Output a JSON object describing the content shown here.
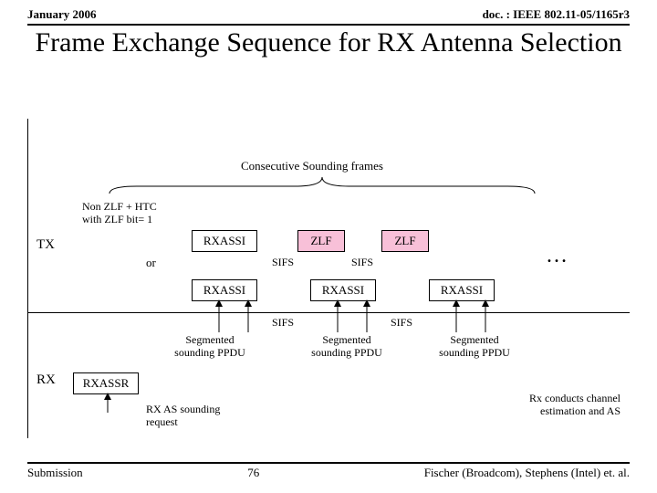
{
  "header": {
    "date": "January 2006",
    "docref": "doc. : IEEE 802.11-05/1165r3"
  },
  "title": "Frame Exchange Sequence for RX Antenna Selection",
  "footer": {
    "left": "Submission",
    "slide": "76",
    "right": "Fischer (Broadcom), Stephens (Intel) et. al."
  },
  "roles": {
    "tx": "TX",
    "rx": "RX"
  },
  "labels": {
    "consecutive": "Consecutive Sounding frames",
    "nonzlf_line1": "Non ZLF + HTC",
    "nonzlf_line2": "with ZLF bit= 1",
    "or": "or",
    "sifs": "SIFS",
    "segppdu_line1": "Segmented",
    "segppdu_line2": "sounding PPDU",
    "rxreq_line1": "RX AS sounding",
    "rxreq_line2": "request",
    "rxconducts_line1": "Rx conducts channel",
    "rxconducts_line2": "estimation and AS",
    "ellipsis": "…"
  },
  "frames": {
    "rxassi": "RXASSI",
    "zlf": "ZLF",
    "rxassr": "RXASSR"
  }
}
